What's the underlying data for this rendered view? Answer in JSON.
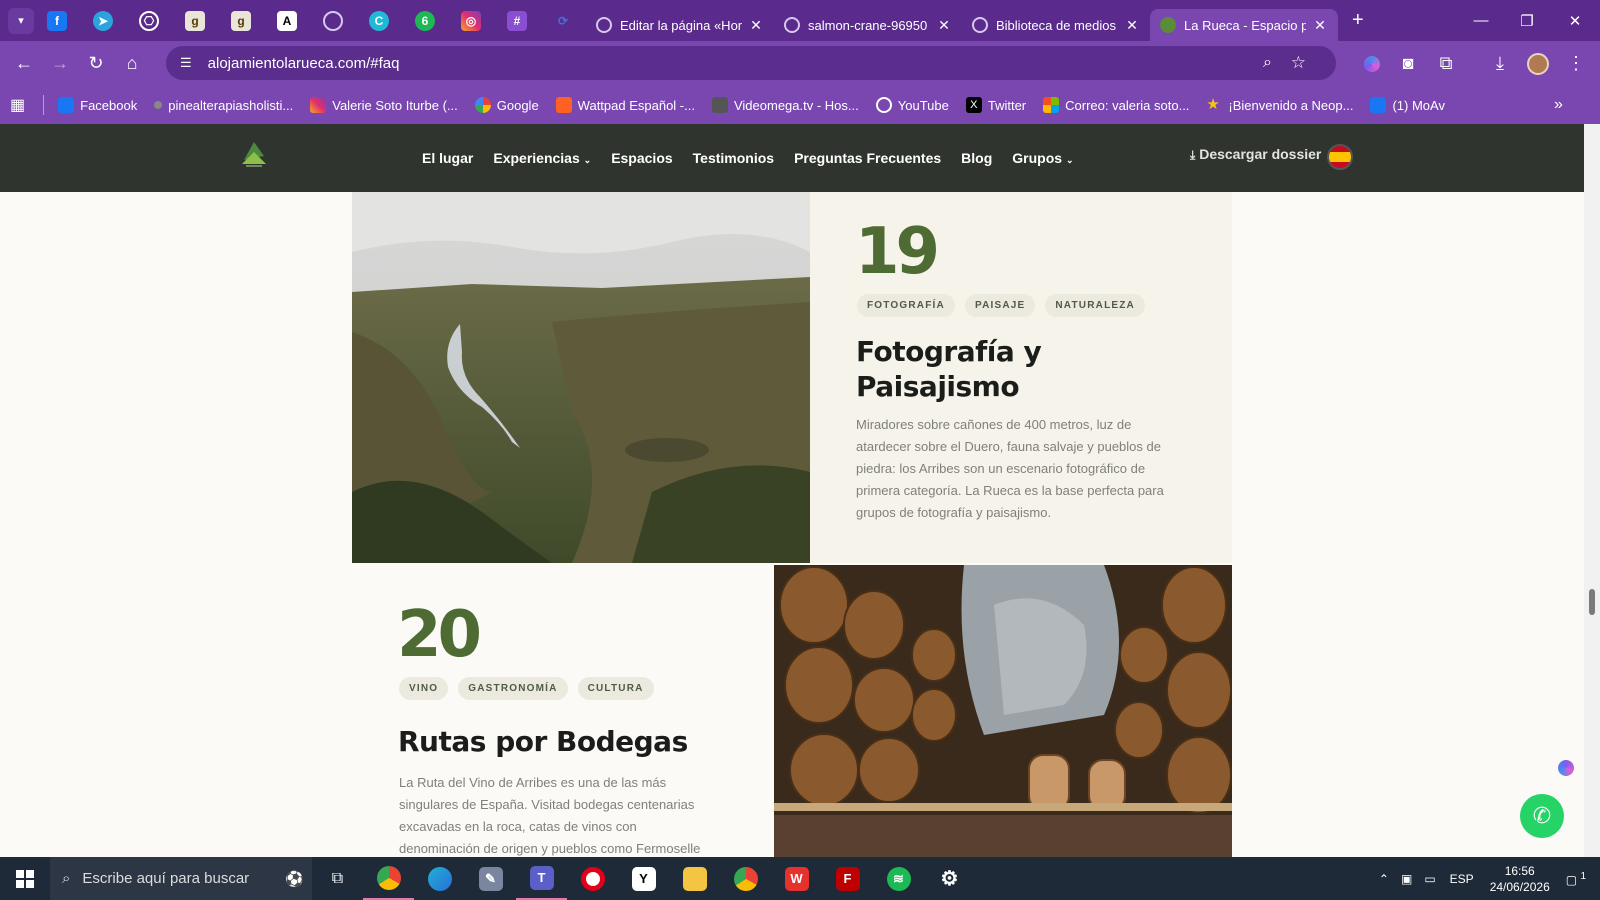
{
  "browser": {
    "tabs": [
      {
        "title": "Editar la página «Hor",
        "active": false
      },
      {
        "title": "salmon-crane-96950",
        "active": false
      },
      {
        "title": "Biblioteca de medios",
        "active": false
      },
      {
        "title": "La Rueca - Espacio p",
        "active": true
      }
    ],
    "pinned_tabs": [
      "facebook-icon",
      "telegram-icon",
      "openai-icon",
      "goodreads-icon",
      "goodreads-icon",
      "font-a-icon",
      "globe-icon",
      "canva-icon",
      "number-6-icon",
      "instagram-icon",
      "slack-icon",
      "tool-icon"
    ],
    "url": "alojamientolarueca.com/#faq",
    "bookmarks": [
      {
        "label": "Facebook",
        "icon": "facebook-icon",
        "color": "#1877f2"
      },
      {
        "label": "pinealterapiasholisti...",
        "icon": "dot-icon",
        "color": "#888888"
      },
      {
        "label": "Valerie Soto Iturbe (...",
        "icon": "instagram-icon",
        "color": "#e1306c"
      },
      {
        "label": "Google",
        "icon": "google-icon",
        "color": "#ffffff"
      },
      {
        "label": "Wattpad Español -...",
        "icon": "wattpad-icon",
        "color": "#ff6122"
      },
      {
        "label": "Videomega.tv - Hos...",
        "icon": "vm-icon",
        "color": "#555555"
      },
      {
        "label": "YouTube",
        "icon": "globe-icon",
        "color": "#ffffff"
      },
      {
        "label": "Twitter",
        "icon": "x-icon",
        "color": "#000000"
      },
      {
        "label": "Correo: valeria soto...",
        "icon": "microsoft-icon",
        "color": "#f25022"
      },
      {
        "label": "¡Bienvenido a Neop...",
        "icon": "star-icon",
        "color": "#f5c518"
      },
      {
        "label": "(1) MoAv",
        "icon": "facebook-icon",
        "color": "#1877f2"
      }
    ]
  },
  "site": {
    "nav": [
      "El lugar",
      "Experiencias",
      "Espacios",
      "Testimonios",
      "Preguntas Frecuentes",
      "Blog",
      "Grupos"
    ],
    "download": "Descargar dossier"
  },
  "cards": [
    {
      "number": "19",
      "tags": [
        "FOTOGRAFÍA",
        "PAISAJE",
        "NATURALEZA"
      ],
      "title_line1": "Fotografía y",
      "title_line2": "Paisajismo",
      "body": [
        "Miradores sobre cañones de 400 metros, luz de",
        "atardecer sobre el Duero, fauna salvaje y pueblos de",
        "piedra: los Arribes son un escenario fotográfico de",
        "primera categoría. La Rueca es la base perfecta para",
        "grupos de fotografía y paisajismo."
      ]
    },
    {
      "number": "20",
      "tags": [
        "VINO",
        "GASTRONOMÍA",
        "CULTURA"
      ],
      "title_line1": "Rutas por Bodegas",
      "body": [
        "La Ruta del Vino de Arribes es una de las más",
        "singulares de España. Visitad bodegas centenarias",
        "excavadas en la roca, catas de vinos con",
        "denominación de origen y pueblos como Fermoselle"
      ]
    }
  ],
  "taskbar": {
    "search_placeholder": "Escribe aquí para buscar",
    "lang": "ESP",
    "time": "16:56",
    "date": "24/06/2026",
    "notifications": "1"
  }
}
